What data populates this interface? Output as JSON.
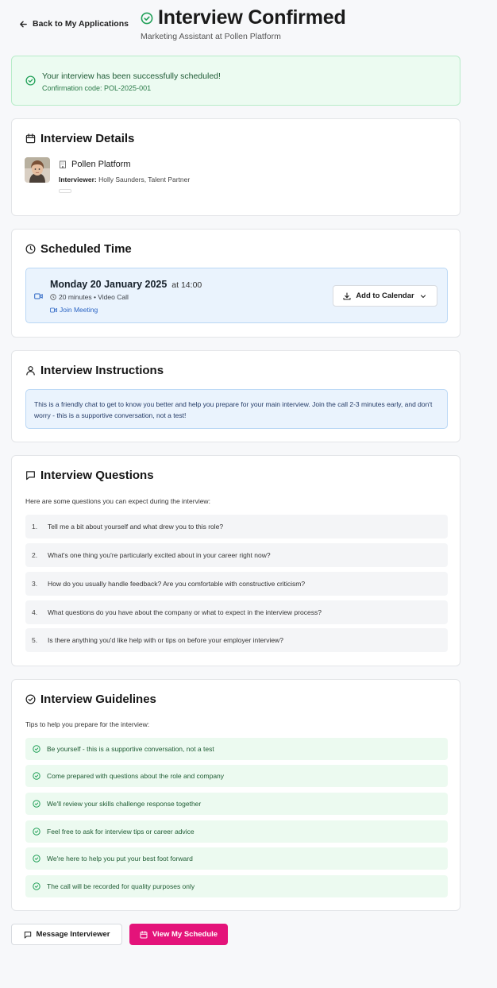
{
  "header": {
    "back_label": "Back to My Applications",
    "title": "Interview Confirmed",
    "subtitle": "Marketing Assistant at Pollen Platform"
  },
  "banner": {
    "message": "Your interview has been successfully scheduled!",
    "code": "Confirmation code: POL-2025-001"
  },
  "details": {
    "title": "Interview Details",
    "company": "Pollen Platform",
    "interviewer_label": "Interviewer:",
    "interviewer_value": "Holly Saunders, Talent Partner"
  },
  "schedule": {
    "title": "Scheduled Time",
    "date": "Monday 20 January 2025",
    "time": "at 14:00",
    "meta": "20 minutes • Video Call",
    "join": "Join Meeting",
    "calendar_button": "Add to Calendar"
  },
  "instructions": {
    "title": "Interview Instructions",
    "text": "This is a friendly chat to get to know you better and help you prepare for your main interview. Join the call 2-3 minutes early, and don't worry - this is a supportive conversation, not a test!"
  },
  "questions": {
    "title": "Interview Questions",
    "lead": "Here are some questions you can expect during the interview:",
    "items": [
      {
        "num": "1.",
        "text": "Tell me a bit about yourself and what drew you to this role?"
      },
      {
        "num": "2.",
        "text": "What's one thing you're particularly excited about in your career right now?"
      },
      {
        "num": "3.",
        "text": "How do you usually handle feedback? Are you comfortable with constructive criticism?"
      },
      {
        "num": "4.",
        "text": "What questions do you have about the company or what to expect in the interview process?"
      },
      {
        "num": "5.",
        "text": "Is there anything you'd like help with or tips on before your employer interview?"
      }
    ]
  },
  "guidelines": {
    "title": "Interview Guidelines",
    "lead": "Tips to help you prepare for the interview:",
    "items": [
      "Be yourself - this is a supportive conversation, not a test",
      "Come prepared with questions about the role and company",
      "We'll review your skills challenge response together",
      "Feel free to ask for interview tips or career advice",
      "We're here to help you put your best foot forward",
      "The call will be recorded for quality purposes only"
    ]
  },
  "actions": {
    "message_label": "Message Interviewer",
    "schedule_label": "View My Schedule"
  },
  "colors": {
    "accent": "#e4137a",
    "success": "#21a058",
    "info_bg": "#eaf3fd",
    "link": "#2a64c4"
  }
}
